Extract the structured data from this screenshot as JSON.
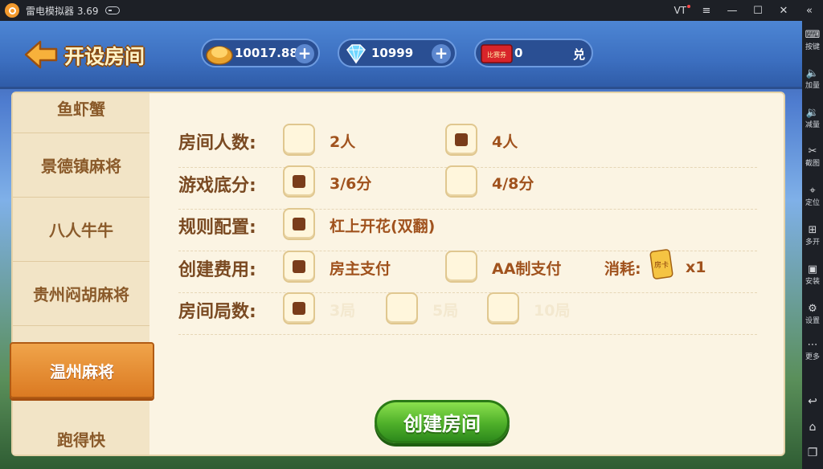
{
  "emulator": {
    "title": "雷电模拟器 3.69",
    "vt_label": "VT",
    "window_controls": [
      "≡",
      "—",
      "☐",
      "✕",
      "«"
    ]
  },
  "sidebar": {
    "items": [
      {
        "label": "按键",
        "icon": "keyboard-icon"
      },
      {
        "label": "加量",
        "icon": "volume-up-icon"
      },
      {
        "label": "减量",
        "icon": "volume-down-icon"
      },
      {
        "label": "截图",
        "icon": "scissors-icon"
      },
      {
        "label": "定位",
        "icon": "location-pin-icon"
      },
      {
        "label": "多开",
        "icon": "multi-open-icon"
      },
      {
        "label": "安装",
        "icon": "apk-install-icon"
      },
      {
        "label": "设置",
        "icon": "gear-icon"
      },
      {
        "label": "更多",
        "icon": "more-dots-icon"
      }
    ],
    "nav": [
      {
        "label": "",
        "icon": "back-arrow-icon"
      },
      {
        "label": "",
        "icon": "home-icon"
      },
      {
        "label": "",
        "icon": "recent-apps-icon"
      }
    ]
  },
  "header": {
    "title": "开设房间",
    "gold": "10017.88",
    "diamond": "10999",
    "ticket_label": "比赛券",
    "ticket": "0",
    "exchange_label": "兑",
    "plus": "+"
  },
  "games": [
    {
      "label": "鱼虾蟹",
      "active": false
    },
    {
      "label": "景德镇麻将",
      "active": false
    },
    {
      "label": "八人牛牛",
      "active": false
    },
    {
      "label": "贵州闷胡麻将",
      "active": false
    },
    {
      "label": "温州麻将",
      "active": true
    },
    {
      "label": "跑得快",
      "active": false
    }
  ],
  "settings": {
    "players": {
      "label": "房间人数:",
      "options": [
        {
          "text": "2人",
          "checked": false
        },
        {
          "text": "4人",
          "checked": true
        }
      ]
    },
    "base_score": {
      "label": "游戏底分:",
      "options": [
        {
          "text": "3/6分",
          "checked": true
        },
        {
          "text": "4/8分",
          "checked": false
        }
      ]
    },
    "rules": {
      "label": "规则配置:",
      "options": [
        {
          "text": "杠上开花(双翻)",
          "checked": true
        }
      ]
    },
    "fee": {
      "label": "创建费用:",
      "options": [
        {
          "text": "房主支付",
          "checked": true
        },
        {
          "text": "AA制支付",
          "checked": false
        }
      ],
      "consume_label": "消耗:",
      "card_text": "房卡",
      "consume_count": "x1"
    },
    "rounds": {
      "label": "房间局数:",
      "options": [
        {
          "text": "3局",
          "checked": true
        },
        {
          "text": "5局",
          "checked": false
        },
        {
          "text": "10局",
          "checked": false
        }
      ]
    }
  },
  "create_button": "创建房间"
}
